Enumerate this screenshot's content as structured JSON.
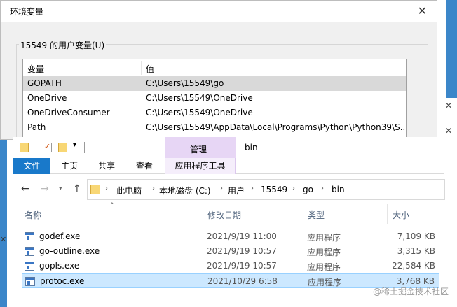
{
  "env_dialog": {
    "title": "环境变量",
    "close_glyph": "✕",
    "group_label": "15549 的用户变量(U)",
    "columns": [
      "变量",
      "值"
    ],
    "rows": [
      {
        "name": "GOPATH",
        "value": "C:\\Users\\15549\\go"
      },
      {
        "name": "OneDrive",
        "value": "C:\\Users\\15549\\OneDrive"
      },
      {
        "name": "OneDriveConsumer",
        "value": "C:\\Users\\15549\\OneDrive"
      },
      {
        "name": "Path",
        "value": "C:\\Users\\15549\\AppData\\Local\\Programs\\Python\\Python39\\S..."
      }
    ]
  },
  "explorer": {
    "title": "bin",
    "contextual_tab": "管理",
    "ribbon_tabs": {
      "file": "文件",
      "home": "主页",
      "share": "共享",
      "view": "查看",
      "apptools": "应用程序工具"
    },
    "breadcrumb": [
      "此电脑",
      "本地磁盘 (C:)",
      "用户",
      "15549",
      "go",
      "bin"
    ],
    "columns": {
      "name": "名称",
      "date": "修改日期",
      "type": "类型",
      "size": "大小"
    },
    "files": [
      {
        "name": "godef.exe",
        "date": "2021/9/19 11:00",
        "type": "应用程序",
        "size": "7,109 KB"
      },
      {
        "name": "go-outline.exe",
        "date": "2021/9/19 10:57",
        "type": "应用程序",
        "size": "3,315 KB"
      },
      {
        "name": "gopls.exe",
        "date": "2021/9/19 10:57",
        "type": "应用程序",
        "size": "22,584 KB"
      },
      {
        "name": "protoc.exe",
        "date": "2021/10/29 6:58",
        "type": "应用程序",
        "size": "3,768 KB"
      }
    ],
    "selected_file": "protoc.exe"
  },
  "watermark": "@稀土掘金技术社区",
  "colors": {
    "file_tab": "#1979ca",
    "manage_tab": "#e7d6f5",
    "selection": "#cce8ff",
    "desktop": "#3b86c9"
  },
  "icons": [
    "back-arrow-icon",
    "forward-arrow-icon",
    "up-arrow-icon",
    "folder-icon",
    "exe-file-icon",
    "close-icon"
  ]
}
